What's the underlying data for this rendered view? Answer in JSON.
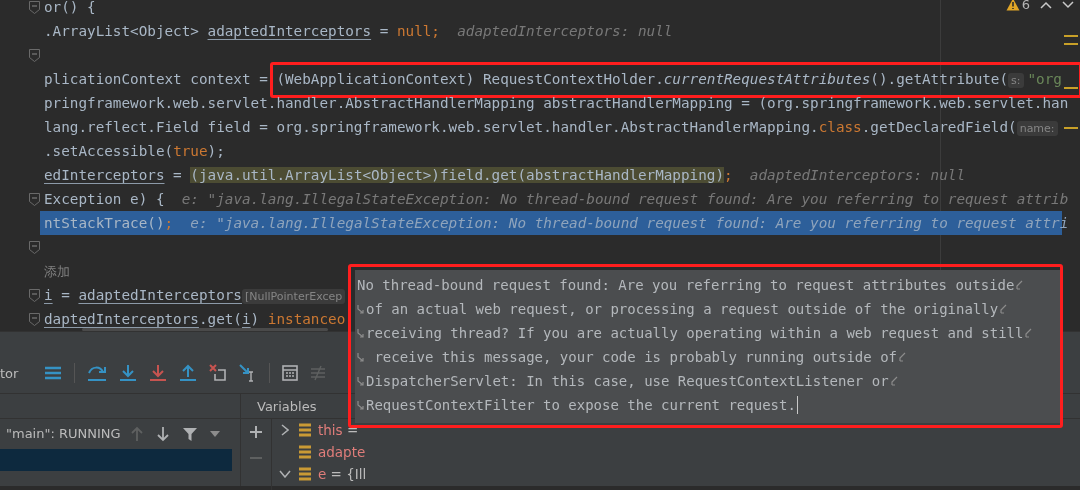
{
  "editor": {
    "lines": [
      {
        "fold_marker": true,
        "selected": false,
        "segments": [
          {
            "text": "or() {",
            "kind": "plain"
          }
        ]
      },
      {
        "fold_marker": false,
        "selected": false,
        "segments": [
          {
            "text": ".ArrayList<Object> ",
            "kind": "plain"
          },
          {
            "text": "adaptedInterceptors",
            "kind": "underline"
          },
          {
            "text": " = ",
            "kind": "plain"
          },
          {
            "text": "null;",
            "kind": "kw"
          },
          {
            "text": "  adaptedInterceptors: null",
            "kind": "hint"
          }
        ]
      },
      {
        "fold_marker": true,
        "selected": false
      },
      {
        "fold_marker": false,
        "selected": false,
        "segments": [
          {
            "text": "plicationContext context = (WebApplicationContext) RequestContextHolder.",
            "kind": "plain"
          },
          {
            "text": "currentRequestAttributes",
            "kind": "italic"
          },
          {
            "text": "().getAttribute(",
            "kind": "plain"
          },
          {
            "text": "s:",
            "kind": "param"
          },
          {
            "text": "\"org",
            "kind": "string"
          }
        ]
      },
      {
        "fold_marker": false,
        "selected": false,
        "segments": [
          {
            "text": "pringframework.web.servlet.handler.AbstractHandlerMapping abstractHandlerMapping = (org.springframework.web.servlet.han",
            "kind": "plain"
          }
        ]
      },
      {
        "fold_marker": false,
        "selected": false,
        "segments": [
          {
            "text": "lang.reflect.Field field = org.springframework.web.servlet.handler.AbstractHandlerMapping.",
            "kind": "plain"
          },
          {
            "text": "class",
            "kind": "kw"
          },
          {
            "text": ".getDeclaredField(",
            "kind": "plain"
          },
          {
            "text": "name:",
            "kind": "param"
          }
        ]
      },
      {
        "fold_marker": false,
        "selected": false,
        "segments": [
          {
            "text": ".setAccessible(",
            "kind": "plain"
          },
          {
            "text": "true",
            "kind": "kw"
          },
          {
            "text": ");",
            "kind": "plain"
          }
        ]
      },
      {
        "fold_marker": false,
        "selected": false,
        "segments": [
          {
            "text": "edInterceptors",
            "kind": "underline"
          },
          {
            "text": " = ",
            "kind": "plain"
          },
          {
            "text": "(java.util.ArrayList<Object>)field.get(abstractHandlerMapping)",
            "kind": "eval"
          },
          {
            "text": ";",
            "kind": "kw"
          },
          {
            "text": "  adaptedInterceptors: null",
            "kind": "hint"
          }
        ]
      },
      {
        "fold_marker": true,
        "selected": false,
        "segments": [
          {
            "text": "Exception e) {",
            "kind": "plain"
          },
          {
            "text": "  e: \"java.lang.IllegalStateException: No thread-bound request found: Are you referring to request attrib",
            "kind": "hint"
          }
        ]
      },
      {
        "fold_marker": false,
        "selected": true,
        "segments": [
          {
            "text": "ntStackTrace()",
            "kind": "plain"
          },
          {
            "text": ";",
            "kind": "kw"
          },
          {
            "text": "  e: \"java.lang.IllegalStateException: No thread-bound request found: Are you referring to request attri",
            "kind": "hint"
          }
        ]
      },
      {
        "fold_marker": true,
        "selected": false
      },
      {
        "fold_marker": false,
        "selected": false,
        "segments": [
          {
            "text": "添加",
            "kind": "comment"
          }
        ]
      },
      {
        "fold_marker": true,
        "selected": false,
        "segments": [
          {
            "text": "i",
            "kind": "underline"
          },
          {
            "text": " = ",
            "kind": "plain"
          },
          {
            "text": "adaptedInterceptors",
            "kind": "underline"
          },
          {
            "text": "[NullPointerExcep",
            "kind": "param"
          }
        ]
      },
      {
        "fold_marker": true,
        "selected": false,
        "segments": [
          {
            "text": "daptedInterceptors",
            "kind": "underline"
          },
          {
            "text": ".get(",
            "kind": "plain"
          },
          {
            "text": "i",
            "kind": "underline"
          },
          {
            "text": ") ",
            "kind": "plain"
          },
          {
            "text": "instanceo",
            "kind": "kw"
          }
        ]
      }
    ],
    "warning_count": "6"
  },
  "debug_panel": {
    "tab_label": "tor",
    "thread": "\"main\": RUNNING",
    "variables_header": "Variables",
    "variables": [
      {
        "kind": "node",
        "expanded": false,
        "name": "this",
        "rest": " ="
      },
      {
        "kind": "leaf",
        "name": "adapte"
      },
      {
        "kind": "node",
        "expanded": true,
        "name": "e",
        "rest": " = {Ill"
      }
    ]
  },
  "tooltip": {
    "lines": [
      {
        "wrap_before": false,
        "text": "No thread-bound request found: Are you referring to request attributes outside",
        "wrap_after": true
      },
      {
        "wrap_before": true,
        "text": "of an actual web request, or processing a request outside of the originally",
        "wrap_after": true
      },
      {
        "wrap_before": true,
        "text": "receiving thread? If you are actually operating within a web request and still",
        "wrap_after": true
      },
      {
        "wrap_before": true,
        "text": " receive this message, your code is probably running outside of",
        "wrap_after": true
      },
      {
        "wrap_before": true,
        "text": "DispatcherServlet: In this case, use RequestContextListener or",
        "wrap_after": true
      },
      {
        "wrap_before": true,
        "text": "RequestContextFilter to expose the current request.",
        "wrap_after": false
      }
    ]
  }
}
